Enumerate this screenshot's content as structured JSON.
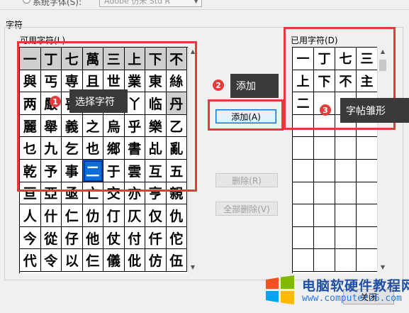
{
  "top": {
    "radio_label": "系统字体(S):",
    "font_value": "Adobe 仿宋 Std R"
  },
  "section_label": "字符",
  "available": {
    "label": "可用字符(L)",
    "rows": [
      [
        "一",
        "丁",
        "七",
        "萬",
        "三",
        "上",
        "下",
        "不"
      ],
      [
        "與",
        "丐",
        "専",
        "且",
        "世",
        "業",
        "東",
        "絲"
      ],
      [
        "两",
        "嚴",
        "喪",
        "丨",
        "个",
        "丫",
        "临",
        "丹"
      ],
      [
        "麗",
        "舉",
        "義",
        "之",
        "烏",
        "乎",
        "樂",
        "乙"
      ],
      [
        "乜",
        "九",
        "乞",
        "也",
        "鄉",
        "書",
        "乩",
        "亂"
      ],
      [
        "乾",
        "予",
        "事",
        "二",
        "于",
        "雲",
        "互",
        "五"
      ],
      [
        "亘",
        "亞",
        "亟",
        "亡",
        "交",
        "亦",
        "亨",
        "親"
      ],
      [
        "人",
        "什",
        "仁",
        "仂",
        "仃",
        "仄",
        "仅",
        "仇"
      ],
      [
        "今",
        "從",
        "仔",
        "他",
        "仗",
        "付",
        "仟",
        "佗"
      ],
      [
        "代",
        "令",
        "以",
        "仨",
        "儀",
        "仳",
        "仿",
        "伍"
      ]
    ],
    "selected": "二"
  },
  "used": {
    "label": "已用字符(D)",
    "rows": [
      [
        "一",
        "丁",
        "七",
        "三"
      ],
      [
        "上",
        "下",
        "不",
        "主"
      ],
      [
        "二",
        "",
        "",
        ""
      ],
      [
        "",
        "",
        "",
        ""
      ],
      [
        "",
        "",
        "",
        ""
      ],
      [
        "",
        "",
        "",
        ""
      ],
      [
        "",
        "",
        "",
        ""
      ],
      [
        "",
        "",
        "",
        ""
      ],
      [
        "",
        "",
        "",
        ""
      ],
      [
        "",
        "",
        "",
        ""
      ]
    ]
  },
  "buttons": {
    "add": "添加(A)",
    "delete": "删除(R)",
    "delete_all": "全部删除(V)",
    "close": "关闭"
  },
  "callouts": [
    {
      "num": "1",
      "text": "选择字符"
    },
    {
      "num": "2",
      "text": "添加"
    },
    {
      "num": "3",
      "text": "字帖雏形"
    }
  ],
  "watermark": {
    "title": "电脑软硬件教程网",
    "url": "www.computer26.com"
  },
  "colors": {
    "highlight": "#e8383d",
    "selected_cell": "#0a6cd6",
    "header_gray": "#cfcfcf",
    "callout_bg": "#3a3a3a"
  }
}
